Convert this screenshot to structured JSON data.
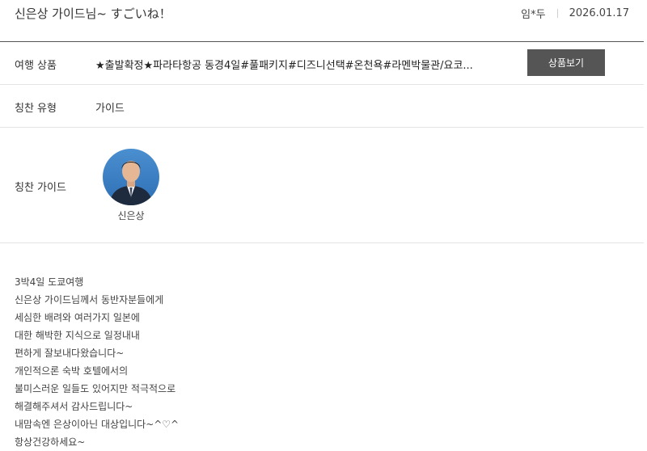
{
  "header": {
    "title": "신은상 가이드님~ すごいね！",
    "author": "임*두",
    "date": "2026.01.17"
  },
  "product_row": {
    "label": "여행 상품",
    "value": "★출발확정★파라타항공 동경4일#풀패키지#디즈니선택#온천욕#라멘박물관/요코...",
    "button_label": "상품보기"
  },
  "type_row": {
    "label": "칭찬 유형",
    "value": "가이드"
  },
  "guide_row": {
    "label": "칭찬 가이드",
    "guide_name": "신은상"
  },
  "body": {
    "lines": [
      "3박4일 도쿄여행",
      "신은상 가이드님께서 동반자분들에게",
      "세심한 배려와 여러가지 일본에",
      "대한 해박한 지식으로 일정내내",
      "편하게 잘보내다왔습니다~",
      "개인적으론 숙박 호텔에서의",
      "불미스러운 일들도 있어지만 적극적으로",
      "해결해주셔서 감사드립니다~",
      "내맘속엔 은상이아닌 대상입니다~^♡^",
      "항상건강하세요~"
    ]
  },
  "colors": {
    "button_bg": "#555555",
    "button_text": "#ffffff",
    "divider": "#e4e4e4",
    "header_divider": "#555555"
  }
}
